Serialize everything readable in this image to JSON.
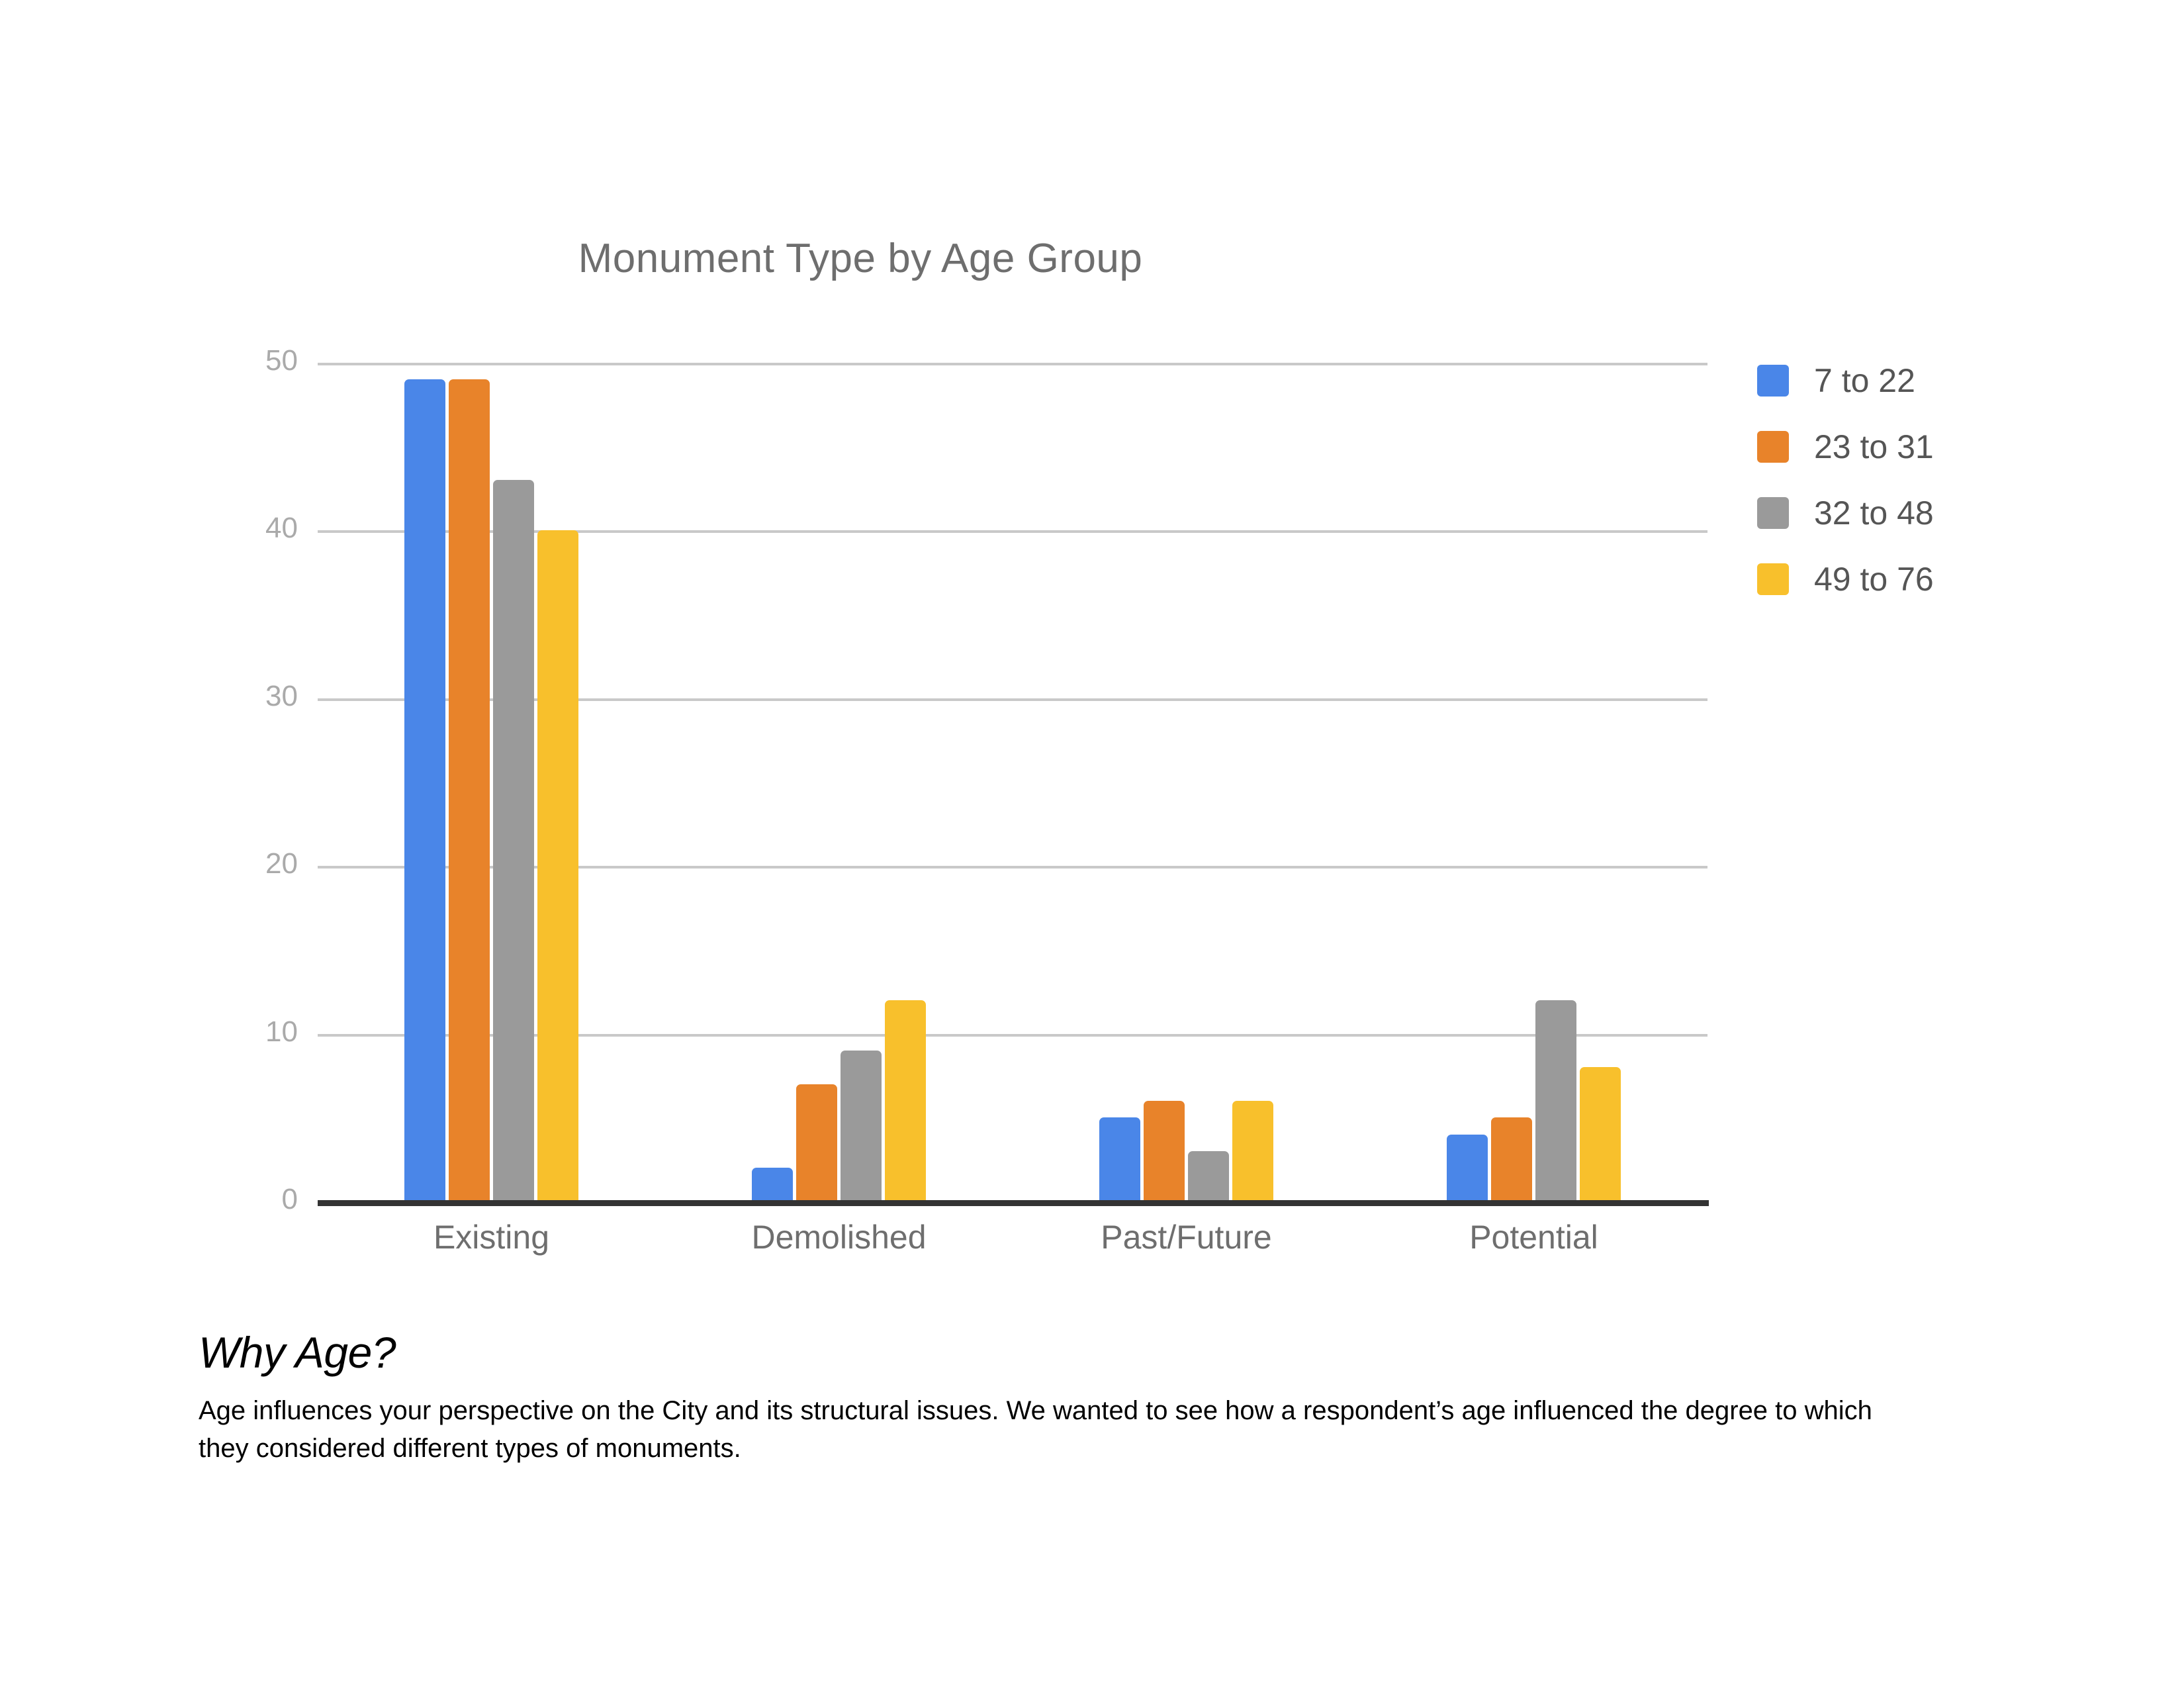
{
  "chart_data": {
    "type": "bar",
    "title": "Monument Type by Age Group",
    "xlabel": "",
    "ylabel": "",
    "ylim": [
      0,
      50
    ],
    "yticks": [
      0,
      10,
      20,
      30,
      40,
      50
    ],
    "ytick_labels": [
      "0",
      "10",
      "20",
      "30",
      "40",
      "50"
    ],
    "grid": true,
    "legend_position": "right",
    "categories": [
      "Existing",
      "Demolished",
      "Past/Future",
      "Potential"
    ],
    "series": [
      {
        "name": "7 to 22",
        "color": "#4a86e8",
        "values": [
          49,
          2,
          5,
          4
        ]
      },
      {
        "name": "23 to 31",
        "color": "#e8832a",
        "values": [
          49,
          7,
          6,
          5
        ]
      },
      {
        "name": "32 to 48",
        "color": "#9a9a9a",
        "values": [
          43,
          9,
          3,
          12
        ]
      },
      {
        "name": "49 to 76",
        "color": "#f8c02c",
        "values": [
          40,
          12,
          6,
          8
        ]
      }
    ]
  },
  "caption": {
    "heading": "Why Age?",
    "paragraph": "Age influences your perspective on the City and its structural issues. We wanted to see how a respondent’s age influenced the degree to which they considered different types of monuments."
  },
  "colors": {
    "title_text": "#6e6e6e",
    "tick_text": "#aaaaaa",
    "category_text": "#6e6e6e",
    "gridline": "#c9c9c9",
    "axis_line": "#333333",
    "legend_text": "#555555",
    "background": "#ffffff"
  }
}
